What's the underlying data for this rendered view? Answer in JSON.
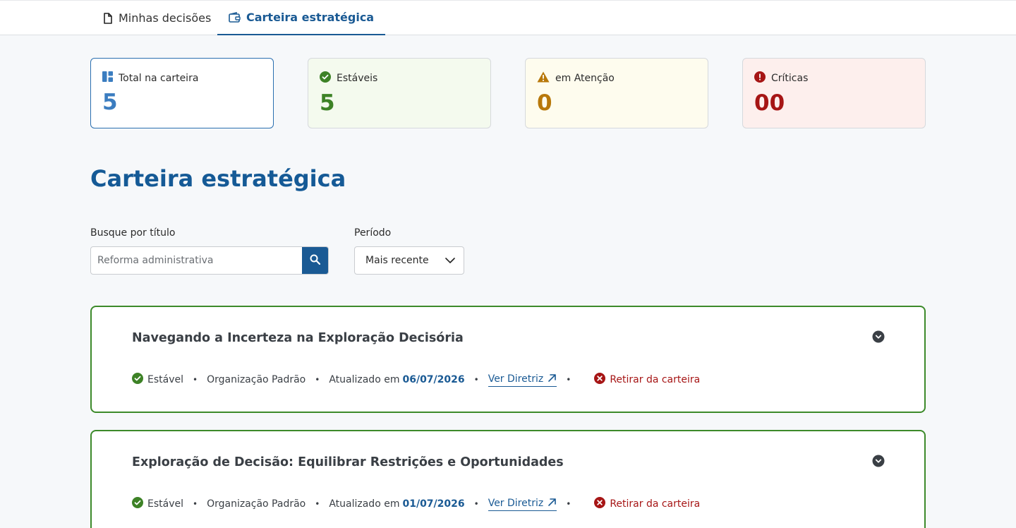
{
  "tabs": [
    {
      "label": "Minhas decisões",
      "active": false
    },
    {
      "label": "Carteira estratégica",
      "active": true
    }
  ],
  "stats": {
    "total": {
      "label": "Total na carteira",
      "value": "5"
    },
    "stable": {
      "label": "Estáveis",
      "value": "5"
    },
    "attention": {
      "label": "em Atenção",
      "value": "0"
    },
    "critical": {
      "label": "Críticas",
      "value": "00"
    }
  },
  "page_title": "Carteira estratégica",
  "search": {
    "label": "Busque por título",
    "placeholder": "Reforma administrativa"
  },
  "period": {
    "label": "Período",
    "selected": "Mais recente"
  },
  "items": [
    {
      "title": "Navegando a Incerteza na Exploração Decisória",
      "status": "Estável",
      "organization": "Organização Padrão",
      "updated_label": "Atualizado em",
      "updated_date": "06/07/2026",
      "link_label": "Ver Diretriz",
      "remove_label": "Retirar da carteira"
    },
    {
      "title": "Exploração de Decisão: Equilibrar Restrições e Oportunidades",
      "status": "Estável",
      "organization": "Organização Padrão",
      "updated_label": "Atualizado em",
      "updated_date": "01/07/2026",
      "link_label": "Ver Diretriz",
      "remove_label": "Retirar da carteira"
    }
  ],
  "colors": {
    "primary": "#1a5a94",
    "stable": "#3d8226",
    "attention": "#b8780a",
    "critical": "#a61515"
  },
  "icons": {
    "tab1": "document-icon",
    "tab2": "wallet-icon",
    "total": "dashboard-icon",
    "stable": "check-circle-icon",
    "attention": "warning-triangle-icon",
    "critical": "error-circle-icon",
    "search": "search-icon",
    "select": "chevron-down-icon",
    "expand": "chevron-down-circle-icon",
    "link": "external-arrow-icon",
    "remove": "close-circle-icon"
  }
}
